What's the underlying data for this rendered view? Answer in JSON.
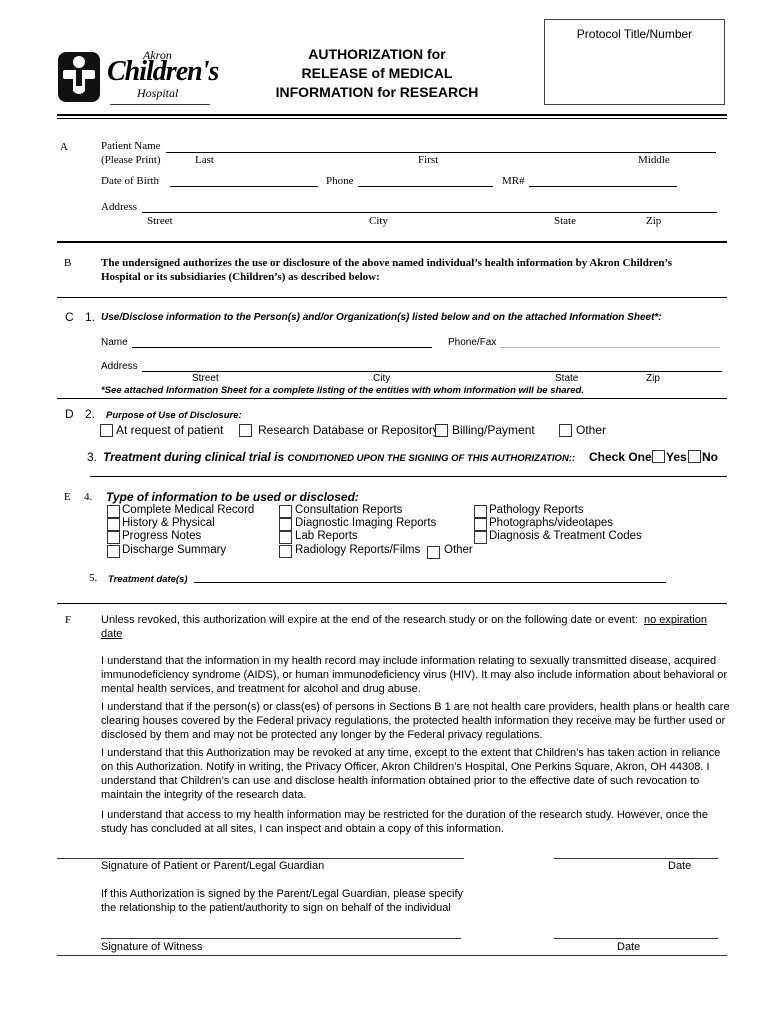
{
  "header": {
    "logo": {
      "line1": "Akron",
      "line2": "Children's",
      "line3": "Hospital"
    },
    "title_lines": [
      "AUTHORIZATION for",
      "RELEASE of MEDICAL",
      "INFORMATION for RESEARCH"
    ],
    "protocol_box_label": "Protocol Title/Number"
  },
  "section_a": {
    "letter": "A",
    "patient_name_label": "Patient Name",
    "please_print": "(Please Print)",
    "name_parts": [
      "Last",
      "First",
      "Middle"
    ],
    "dob_label": "Date of Birth",
    "phone_label": "Phone",
    "mr_label": "MR#",
    "address_label": "Address",
    "address_parts": [
      "Street",
      "City",
      "State",
      "Zip"
    ]
  },
  "section_b": {
    "letter": "B",
    "text": "The undersigned authorizes the use or disclosure of the above named individual’s health information by Akron Children’s Hospital or its subsidiaries (Children’s) as described below:"
  },
  "section_c": {
    "letter": "C",
    "num": "1.",
    "heading": "Use/Disclose information to the Person(s) and/or Organization(s) listed below and on the attached Information Sheet*:",
    "name_label": "Name",
    "phone_fax_label": "Phone/Fax",
    "address_label": "Address",
    "address_parts": [
      "Street",
      "City",
      "State",
      "Zip"
    ],
    "footnote": "*See attached Information Sheet for a complete listing of the entities with whom information will be shared."
  },
  "section_d": {
    "letter": "D",
    "num": "2.",
    "heading": "Purpose of Use of Disclosure:",
    "options": [
      "At request of patient",
      "Research Database or Repository",
      "Billing/Payment",
      "Other"
    ],
    "q3_num": "3.",
    "q3_text_a": "Treatment during clinical trial is ",
    "q3_text_b": "CONDITIONED UPON THE SIGNING OF THIS AUTHORIZATION::",
    "check_one": "Check One:",
    "yes": "Yes",
    "no": "No"
  },
  "section_e": {
    "letter": "E",
    "num": "4.",
    "heading": "Type of information to be used or disclosed:",
    "col1": [
      "Complete Medical Record",
      "History & Physical",
      "Progress Notes",
      "Discharge Summary"
    ],
    "col2": [
      "Consultation Reports",
      "Diagnostic Imaging Reports",
      "Lab Reports",
      "Radiology Reports/Films"
    ],
    "col2_other": "Other",
    "col3": [
      "Pathology Reports",
      "Photographs/videotapes",
      "Diagnosis & Treatment Codes"
    ],
    "q5_num": "5.",
    "q5_label": "Treatment date(s)"
  },
  "section_f": {
    "letter": "F",
    "expiry_text": "Unless revoked, this authorization will expire at the end of the research study or on the following date or event:",
    "expiry_value_1": "no expiration",
    "expiry_value_2": "date",
    "paragraphs": [
      "I understand that the information in my health record may include information relating to sexually transmitted disease, acquired immunodeficiency syndrome (AIDS), or human immunodeficiency virus (HIV).  It may also include information about behavioral or mental health services, and treatment for alcohol and drug abuse.",
      "I understand that if the person(s) or class(es) of persons in Sections B 1 are not health care providers, health plans or health care clearing houses covered by the Federal privacy regulations, the protected health information they receive may be further used or disclosed by them and may not be protected any longer by the Federal privacy regulations.",
      "I understand that this Authorization may be revoked at any time, except to the extent that Children’s has taken action in reliance on this Authorization.  Notify in writing, the Privacy Officer, Akron Children’s Hospital, One Perkins Square, Akron, OH 44308.  I understand that Children’s can use and disclose health information obtained prior to the effective date of such revocation  to maintain the integrity of the research data.",
      "I understand that access to my health information may be restricted for the duration of the research study.  However, once the study has concluded at all sites, I can inspect and obtain a copy of this information."
    ]
  },
  "signatures": {
    "patient_sig_label": "Signature of Patient or Parent/Legal Guardian",
    "date_label": "Date",
    "guardian_note": [
      "If this Authorization is signed by the Parent/Legal Guardian, please specify",
      "the relationship to the patient/authority to sign on behalf of the individual"
    ],
    "witness_sig_label": "Signature of Witness",
    "witness_date_label": "Date"
  }
}
